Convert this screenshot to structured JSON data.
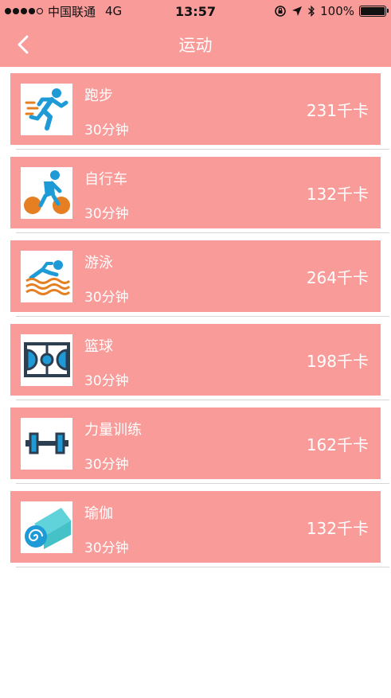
{
  "status_bar": {
    "carrier": "中国联通",
    "network": "4G",
    "time": "13:57",
    "battery": "100%",
    "icons": [
      "signal-icon",
      "rotation-lock-icon",
      "location-arrow-icon",
      "bluetooth-icon",
      "battery-icon"
    ]
  },
  "nav": {
    "title": "运动",
    "back_icon": "chevron-left-icon"
  },
  "colors": {
    "accent": "#f99b99",
    "text_on_accent": "#ffffff",
    "separator": "#d6d6d6",
    "icon_blue": "#1e9bd7",
    "icon_orange": "#e67e22",
    "icon_navy": "#2c3e50"
  },
  "exercises": [
    {
      "name": "跑步",
      "duration": "30分钟",
      "calories": "231千卡",
      "icon": "running-icon"
    },
    {
      "name": "自行车",
      "duration": "30分钟",
      "calories": "132千卡",
      "icon": "cycling-icon"
    },
    {
      "name": "游泳",
      "duration": "30分钟",
      "calories": "264千卡",
      "icon": "swimming-icon"
    },
    {
      "name": "篮球",
      "duration": "30分钟",
      "calories": "198千卡",
      "icon": "basketball-court-icon"
    },
    {
      "name": "力量训练",
      "duration": "30分钟",
      "calories": "162千卡",
      "icon": "dumbbell-icon"
    },
    {
      "name": "瑜伽",
      "duration": "30分钟",
      "calories": "132千卡",
      "icon": "yoga-mat-icon"
    }
  ]
}
